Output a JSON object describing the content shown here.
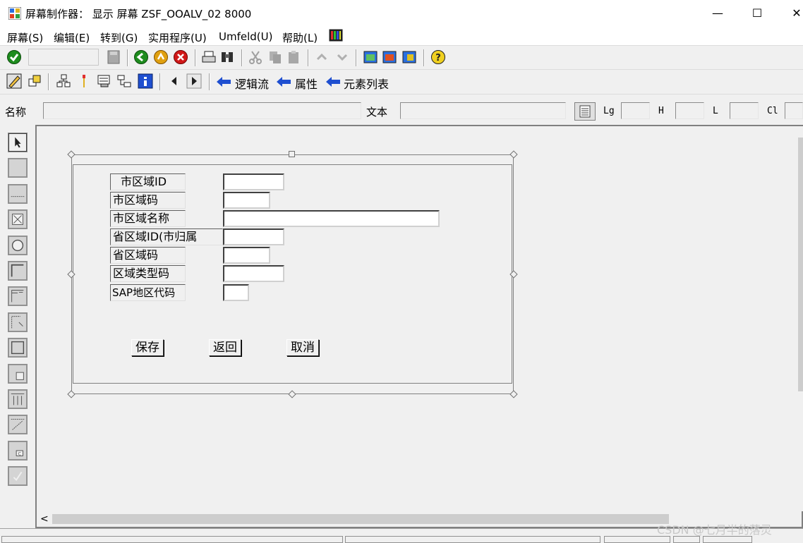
{
  "window": {
    "title": "屏幕制作器： 显示 屏幕 ZSF_OOALV_02 8000",
    "minimize": "—",
    "maximize": "☐",
    "close": "✕"
  },
  "menu": [
    "屏幕(S)",
    "编辑(E)",
    "转到(G)",
    "实用程序(U)",
    "Umfeld(U)",
    "帮助(L)"
  ],
  "toolbar2": {
    "flow_logic": "逻辑流",
    "attributes": "属性",
    "element_list": "元素列表"
  },
  "fieldrow": {
    "name_label": "名称",
    "text_label": "文本",
    "lg_label": "Lg",
    "h_label": "H",
    "l_label": "L",
    "cl_label": "Cl"
  },
  "screen": {
    "fields": [
      {
        "label": "市区域ID"
      },
      {
        "label": "市区域码"
      },
      {
        "label": "市区域名称"
      },
      {
        "label": "省区域ID(市归属"
      },
      {
        "label": "省区域码"
      },
      {
        "label": "区域类型码"
      },
      {
        "label": "SAP地区代码"
      }
    ],
    "buttons": {
      "save": "保存",
      "back": "返回",
      "cancel": "取消"
    }
  },
  "scroll_left": "<",
  "watermark": "CSDN @七月半的落灵",
  "colors": {
    "accent_green": "#1e8c1e",
    "arrow_blue": "#1f4fd0",
    "cancel_red": "#d01818"
  }
}
